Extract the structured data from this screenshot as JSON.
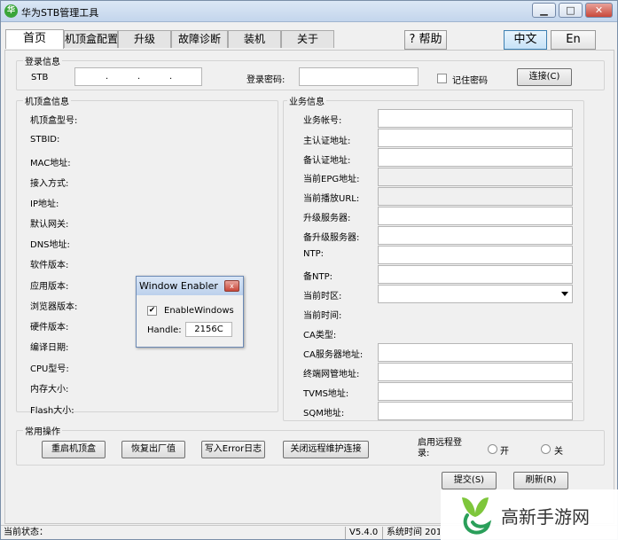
{
  "window": {
    "title": "华为STB管理工具",
    "icon_glyph": "华",
    "buttons": {
      "minimize": "▁",
      "maximize": "□",
      "close": "✕"
    }
  },
  "tabs": [
    {
      "label": "首页",
      "active": true
    },
    {
      "label": "机顶盒配置",
      "active": false
    },
    {
      "label": "升级",
      "active": false
    },
    {
      "label": "故障诊断",
      "active": false
    },
    {
      "label": "装机",
      "active": false
    },
    {
      "label": "关于",
      "active": false
    }
  ],
  "top_buttons": {
    "help": "? 帮助",
    "lang_zh": "中文",
    "lang_en": "En"
  },
  "login": {
    "group_title": "登录信息",
    "stb_label": "STB",
    "ip_dot": ".",
    "password_label": "登录密码:",
    "remember_label": "记住密码",
    "connect_button": "连接(C)"
  },
  "stb_info": {
    "group_title": "机顶盒信息",
    "fields": [
      "机顶盒型号:",
      "STBID:",
      "MAC地址:",
      "接入方式:",
      "IP地址:",
      "默认网关:",
      "DNS地址:",
      "软件版本:",
      "应用版本:",
      "浏览器版本:",
      "硬件版本:",
      "编译日期:",
      "CPU型号:",
      "内存大小:",
      "Flash大小:"
    ]
  },
  "service_info": {
    "group_title": "业务信息",
    "fields": [
      {
        "label": "业务帐号:",
        "type": "input"
      },
      {
        "label": "主认证地址:",
        "type": "input"
      },
      {
        "label": "备认证地址:",
        "type": "input"
      },
      {
        "label": "当前EPG地址:",
        "type": "disabled"
      },
      {
        "label": "当前播放URL:",
        "type": "disabled"
      },
      {
        "label": "升级服务器:",
        "type": "input"
      },
      {
        "label": "备升级服务器:",
        "type": "input"
      },
      {
        "label": "NTP:",
        "type": "input"
      },
      {
        "label": "备NTP:",
        "type": "input"
      },
      {
        "label": "当前时区:",
        "type": "dropdown"
      },
      {
        "label": "当前时间:",
        "type": "none"
      },
      {
        "label": "CA类型:",
        "type": "none"
      },
      {
        "label": "CA服务器地址:",
        "type": "input"
      },
      {
        "label": "终端网管地址:",
        "type": "input"
      },
      {
        "label": "TVMS地址:",
        "type": "input"
      },
      {
        "label": "SQM地址:",
        "type": "input"
      }
    ]
  },
  "common_ops": {
    "group_title": "常用操作",
    "buttons": [
      "重启机顶盒",
      "恢复出厂值",
      "写入Error日志",
      "关闭远程维护连接"
    ],
    "remote_label": "启用远程登录:",
    "remote_on": "开",
    "remote_off": "关"
  },
  "actions": {
    "submit": "提交(S)",
    "refresh": "刷新(R)"
  },
  "status_bar": {
    "status_label": "当前状态：",
    "version": "V5.4.0",
    "system_time": "系统时间 201"
  },
  "popup": {
    "title": "Window Enabler",
    "close_glyph": "x",
    "checkbox_label": "EnableWindows",
    "checkbox_checked": true,
    "handle_label": "Handle:",
    "handle_value": "2156C"
  },
  "watermark": {
    "text": "高新手游网"
  }
}
